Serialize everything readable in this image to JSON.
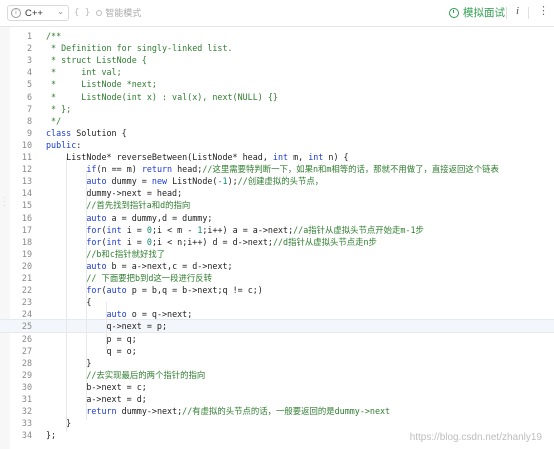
{
  "toolbar": {
    "language": "C++",
    "smart_mode_label": "智能模式",
    "smart_mode_brace": "{ }",
    "mock_interview_label": "模拟面试",
    "info_label": "i",
    "settings_label": "⋮",
    "colors": {
      "accent_green": "#2e9e4f"
    }
  },
  "editor": {
    "colors": {
      "comment": "#2f7d2f",
      "keyword": "#1c3bd0",
      "number": "#0b8a6e",
      "text": "#222222"
    },
    "active_line": 25,
    "lines": [
      {
        "n": "1",
        "tokens": [
          {
            "t": "/**",
            "c": "comment"
          }
        ]
      },
      {
        "n": "2",
        "tokens": [
          {
            "t": " * Definition for singly-linked list.",
            "c": "comment"
          }
        ]
      },
      {
        "n": "3",
        "tokens": [
          {
            "t": " * struct ListNode {",
            "c": "comment"
          }
        ]
      },
      {
        "n": "4",
        "tokens": [
          {
            "t": " *     int val;",
            "c": "comment"
          }
        ]
      },
      {
        "n": "5",
        "tokens": [
          {
            "t": " *     ListNode *next;",
            "c": "comment"
          }
        ]
      },
      {
        "n": "6",
        "tokens": [
          {
            "t": " *     ListNode(int x) : val(x), next(NULL) {}",
            "c": "comment"
          }
        ]
      },
      {
        "n": "7",
        "tokens": [
          {
            "t": " * };",
            "c": "comment"
          }
        ]
      },
      {
        "n": "8",
        "tokens": [
          {
            "t": " */",
            "c": "comment"
          }
        ]
      },
      {
        "n": "9",
        "tokens": [
          {
            "t": "class",
            "c": "kw"
          },
          {
            "t": " Solution {",
            "c": "text"
          }
        ]
      },
      {
        "n": "10",
        "tokens": [
          {
            "t": "public",
            "c": "kw"
          },
          {
            "t": ":",
            "c": "text"
          }
        ]
      },
      {
        "n": "11",
        "tokens": [
          {
            "t": "    ListNode* reverseBetween(ListNode* head, ",
            "c": "text"
          },
          {
            "t": "int",
            "c": "kw"
          },
          {
            "t": " m, ",
            "c": "text"
          },
          {
            "t": "int",
            "c": "kw"
          },
          {
            "t": " n) {",
            "c": "text"
          }
        ]
      },
      {
        "n": "12",
        "tokens": [
          {
            "t": "        ",
            "c": "text"
          },
          {
            "t": "if",
            "c": "kw"
          },
          {
            "t": "(n == m) ",
            "c": "text"
          },
          {
            "t": "return",
            "c": "kw"
          },
          {
            "t": " head;",
            "c": "text"
          },
          {
            "t": "//这里需要特判断一下，如果n和m相等的话，那就不用做了，直接返回这个链表",
            "c": "comment"
          }
        ]
      },
      {
        "n": "13",
        "tokens": [
          {
            "t": "        ",
            "c": "text"
          },
          {
            "t": "auto",
            "c": "kw"
          },
          {
            "t": " dummy = ",
            "c": "text"
          },
          {
            "t": "new",
            "c": "kw"
          },
          {
            "t": " ListNode(",
            "c": "text"
          },
          {
            "t": "-1",
            "c": "num"
          },
          {
            "t": ");",
            "c": "text"
          },
          {
            "t": "//创建虚拟的头节点，",
            "c": "comment"
          }
        ]
      },
      {
        "n": "14",
        "tokens": [
          {
            "t": "        dummy->next = head;",
            "c": "text"
          }
        ]
      },
      {
        "n": "15",
        "tokens": [
          {
            "t": "        ",
            "c": "text"
          },
          {
            "t": "//首先找到指针a和d的指向",
            "c": "comment"
          }
        ]
      },
      {
        "n": "16",
        "tokens": [
          {
            "t": "        ",
            "c": "text"
          },
          {
            "t": "auto",
            "c": "kw"
          },
          {
            "t": " a = dummy,d = dummy;",
            "c": "text"
          }
        ]
      },
      {
        "n": "17",
        "tokens": [
          {
            "t": "        ",
            "c": "text"
          },
          {
            "t": "for",
            "c": "kw"
          },
          {
            "t": "(",
            "c": "text"
          },
          {
            "t": "int",
            "c": "kw"
          },
          {
            "t": " i = ",
            "c": "text"
          },
          {
            "t": "0",
            "c": "num"
          },
          {
            "t": ";i < m - ",
            "c": "text"
          },
          {
            "t": "1",
            "c": "num"
          },
          {
            "t": ";i++) a = a->next;",
            "c": "text"
          },
          {
            "t": "//a指针从虚拟头节点开始走m-1步",
            "c": "comment"
          }
        ]
      },
      {
        "n": "18",
        "tokens": [
          {
            "t": "        ",
            "c": "text"
          },
          {
            "t": "for",
            "c": "kw"
          },
          {
            "t": "(",
            "c": "text"
          },
          {
            "t": "int",
            "c": "kw"
          },
          {
            "t": " i = ",
            "c": "text"
          },
          {
            "t": "0",
            "c": "num"
          },
          {
            "t": ";i < n;i++) d = d->next;",
            "c": "text"
          },
          {
            "t": "//d指针从虚拟头节点走n步",
            "c": "comment"
          }
        ]
      },
      {
        "n": "19",
        "tokens": [
          {
            "t": "        ",
            "c": "text"
          },
          {
            "t": "//b和c指针就好找了",
            "c": "comment"
          }
        ]
      },
      {
        "n": "20",
        "tokens": [
          {
            "t": "        ",
            "c": "text"
          },
          {
            "t": "auto",
            "c": "kw"
          },
          {
            "t": " b = a->next,c = d->next;",
            "c": "text"
          }
        ]
      },
      {
        "n": "21",
        "tokens": [
          {
            "t": "        ",
            "c": "text"
          },
          {
            "t": "// 下面要把b到d这一段进行反转",
            "c": "comment"
          }
        ]
      },
      {
        "n": "22",
        "tokens": [
          {
            "t": "        ",
            "c": "text"
          },
          {
            "t": "for",
            "c": "kw"
          },
          {
            "t": "(",
            "c": "text"
          },
          {
            "t": "auto",
            "c": "kw"
          },
          {
            "t": " p = b,q = b->next;q != c;)",
            "c": "text"
          }
        ]
      },
      {
        "n": "23",
        "tokens": [
          {
            "t": "        {",
            "c": "text"
          }
        ]
      },
      {
        "n": "24",
        "tokens": [
          {
            "t": "            ",
            "c": "text"
          },
          {
            "t": "auto",
            "c": "kw"
          },
          {
            "t": " o = q->next;",
            "c": "text"
          }
        ]
      },
      {
        "n": "25",
        "tokens": [
          {
            "t": "            q->next = p;",
            "c": "text"
          }
        ]
      },
      {
        "n": "26",
        "tokens": [
          {
            "t": "            p = q;",
            "c": "text"
          }
        ]
      },
      {
        "n": "27",
        "tokens": [
          {
            "t": "            q = o;",
            "c": "text"
          }
        ]
      },
      {
        "n": "28",
        "tokens": [
          {
            "t": "        }",
            "c": "text"
          }
        ]
      },
      {
        "n": "29",
        "tokens": [
          {
            "t": "        ",
            "c": "text"
          },
          {
            "t": "//去实现最后的两个指针的指向",
            "c": "comment"
          }
        ]
      },
      {
        "n": "30",
        "tokens": [
          {
            "t": "        b->next = c;",
            "c": "text"
          }
        ]
      },
      {
        "n": "31",
        "tokens": [
          {
            "t": "        a->next = d;",
            "c": "text"
          }
        ]
      },
      {
        "n": "32",
        "tokens": [
          {
            "t": "        ",
            "c": "text"
          },
          {
            "t": "return",
            "c": "kw"
          },
          {
            "t": " dummy->next;",
            "c": "text"
          },
          {
            "t": "//有虚拟的头节点的话，一般要返回的是dummy->next",
            "c": "comment"
          }
        ]
      },
      {
        "n": "33",
        "tokens": [
          {
            "t": "    }",
            "c": "text"
          }
        ]
      },
      {
        "n": "34",
        "tokens": [
          {
            "t": "};",
            "c": "text"
          }
        ]
      }
    ]
  },
  "watermark": "https://blog.csdn.net/zhanly19"
}
